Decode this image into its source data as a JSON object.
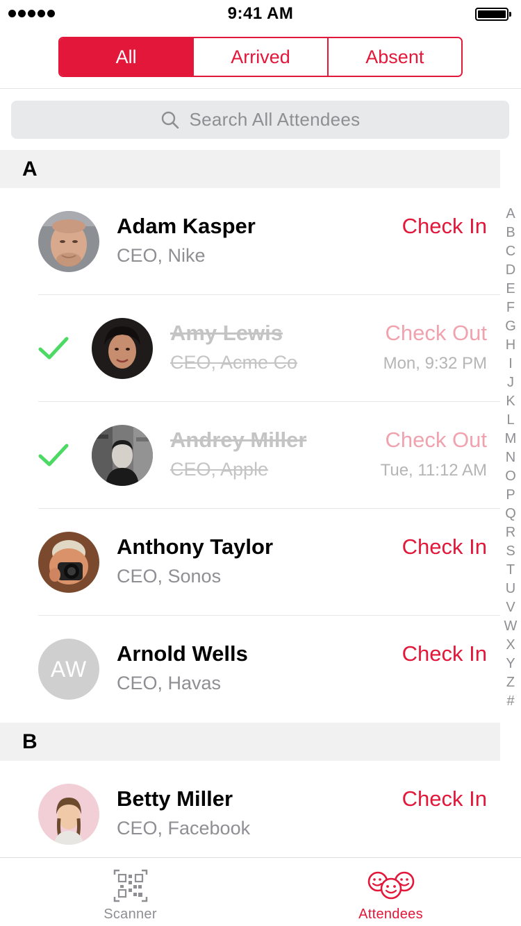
{
  "status_bar": {
    "time": "9:41 AM"
  },
  "filter": {
    "tabs": [
      {
        "label": "All",
        "active": true
      },
      {
        "label": "Arrived",
        "active": false
      },
      {
        "label": "Absent",
        "active": false
      }
    ]
  },
  "search": {
    "placeholder": "Search All Attendees",
    "icon": "search-icon"
  },
  "colors": {
    "accent": "#e3173a",
    "checked": "#4cd964",
    "muted": "#8e8e93"
  },
  "sections": [
    {
      "letter": "A",
      "attendees": [
        {
          "name": "Adam Kasper",
          "title": "CEO, Nike",
          "action": "Check In",
          "checked_in": false
        },
        {
          "name": "Amy Lewis",
          "title": "CEO, Acme Co",
          "action": "Check Out",
          "time": "Mon, 9:32 PM",
          "checked_in": true
        },
        {
          "name": "Andrey Miller",
          "title": "CEO, Apple",
          "action": "Check Out",
          "time": "Tue, 11:12 AM",
          "checked_in": true
        },
        {
          "name": "Anthony Taylor",
          "title": "CEO, Sonos",
          "action": "Check In",
          "checked_in": false
        },
        {
          "name": "Arnold Wells",
          "title": "CEO, Havas",
          "action": "Check In",
          "checked_in": false,
          "initials": "AW"
        }
      ]
    },
    {
      "letter": "B",
      "attendees": [
        {
          "name": "Betty Miller",
          "title": "CEO, Facebook",
          "action": "Check In",
          "checked_in": false
        }
      ]
    }
  ],
  "index": [
    "A",
    "B",
    "C",
    "D",
    "E",
    "F",
    "G",
    "H",
    "I",
    "J",
    "K",
    "L",
    "M",
    "N",
    "O",
    "P",
    "Q",
    "R",
    "S",
    "T",
    "U",
    "V",
    "W",
    "X",
    "Y",
    "Z",
    "#"
  ],
  "tab_bar": {
    "tabs": [
      {
        "label": "Scanner",
        "icon": "qr-code-icon",
        "active": false
      },
      {
        "label": "Attendees",
        "icon": "attendees-icon",
        "active": true
      }
    ]
  }
}
